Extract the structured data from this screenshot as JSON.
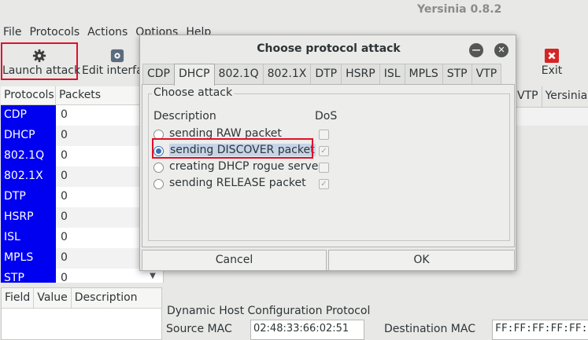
{
  "app": {
    "title": "Yersinia 0.8.2"
  },
  "menu": [
    "File",
    "Protocols",
    "Actions",
    "Options",
    "Help"
  ],
  "toolbar": {
    "launch_label": "Launch attack",
    "edit_label": "Edit interfa",
    "exit_label": "Exit",
    "launch_icon": "gear-icon",
    "edit_icon": "interface-edit-icon",
    "exit_icon": "close-x-icon",
    "highlight_color": "#e0102a"
  },
  "protocols_table": {
    "headers": [
      "Protocols",
      "Packets"
    ],
    "rows": [
      {
        "name": "CDP",
        "packets": "0"
      },
      {
        "name": "DHCP",
        "packets": "0"
      },
      {
        "name": "802.1Q",
        "packets": "0"
      },
      {
        "name": "802.1X",
        "packets": "0"
      },
      {
        "name": "DTP",
        "packets": "0"
      },
      {
        "name": "HSRP",
        "packets": "0"
      },
      {
        "name": "ISL",
        "packets": "0"
      },
      {
        "name": "MPLS",
        "packets": "0"
      },
      {
        "name": "STP",
        "packets": "0"
      }
    ],
    "name_bg": "#0000f0"
  },
  "field_table": {
    "headers": [
      "Field",
      "Value",
      "Description"
    ]
  },
  "right_tabs": [
    "VTP",
    "Yersinia"
  ],
  "dhcp_panel": {
    "title": "Dynamic Host Configuration Protocol",
    "src_mac_label": "Source MAC",
    "src_mac_value": "02:48:33:66:02:51",
    "dst_mac_label": "Destination MAC",
    "dst_mac_value": "FF:FF:FF:FF:FF:"
  },
  "dialog": {
    "title": "Choose protocol attack",
    "tabs": [
      "CDP",
      "DHCP",
      "802.1Q",
      "802.1X",
      "DTP",
      "HSRP",
      "ISL",
      "MPLS",
      "STP",
      "VTP"
    ],
    "active_tab": "DHCP",
    "frame_label": "Choose attack",
    "col_description": "Description",
    "col_dos": "DoS",
    "attacks": [
      {
        "label": "sending RAW packet",
        "selected": false,
        "dos": false
      },
      {
        "label": "sending DISCOVER packet",
        "selected": true,
        "dos": true
      },
      {
        "label": "creating DHCP rogue server",
        "selected": false,
        "dos": false
      },
      {
        "label": "sending RELEASE packet",
        "selected": false,
        "dos": true
      }
    ],
    "cancel_label": "Cancel",
    "ok_label": "OK"
  }
}
